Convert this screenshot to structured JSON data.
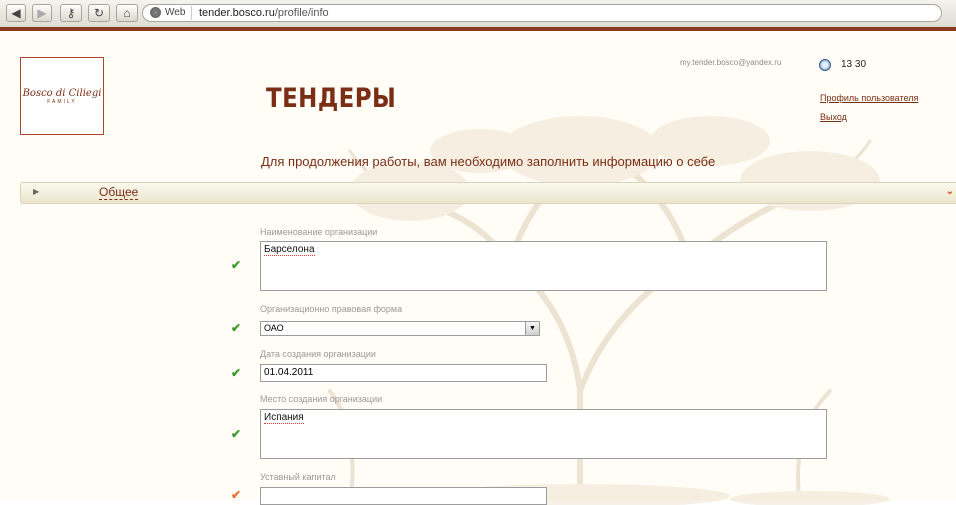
{
  "browser": {
    "url_label": "Web",
    "url_host": "tender.bosco.ru",
    "url_path": "/profile/info"
  },
  "header": {
    "logo_text": "Bosco di Ciliegi",
    "logo_sub": "FAMILY",
    "title": "ТЕНДЕРЫ",
    "email": "my.tender.bosco@yandex.ru",
    "time": "13 30",
    "profile_link": "Профиль пользователя",
    "logout_link": "Выход"
  },
  "notice": "Для продолжения работы, вам необходимо заполнить информацию о себе",
  "section": {
    "title": "Общее"
  },
  "form": {
    "org_name_label": "Наименование организации",
    "org_name_value": "Барселона",
    "legal_form_label": "Организационно правовая форма",
    "legal_form_value": "ОАО",
    "created_date_label": "Дата создания организации",
    "created_date_value": "01.04.2011",
    "created_place_label": "Место создания организации",
    "created_place_value": "Испания",
    "capital_label": "Уставный капитал",
    "capital_value": ""
  },
  "colors": {
    "brand": "#7a2e16",
    "valid": "#3a9a2a",
    "invalid": "#e0703a"
  }
}
